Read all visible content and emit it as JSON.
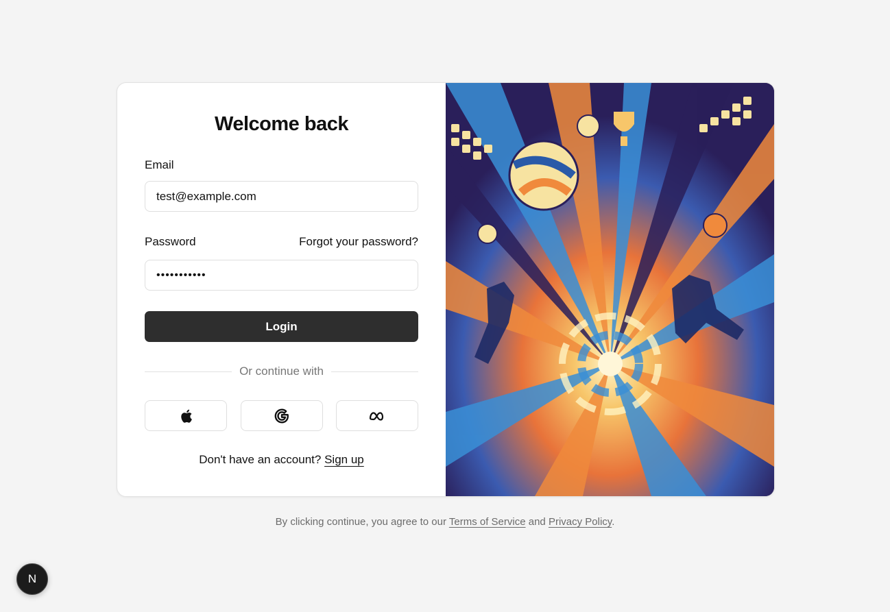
{
  "login_form": {
    "title": "Welcome back",
    "email_label": "Email",
    "email_value": "test@example.com",
    "password_label": "Password",
    "forgot_password": "Forgot your password?",
    "password_value": "•••••••••••",
    "login_button": "Login",
    "divider_text": "Or continue with",
    "social_buttons": [
      {
        "provider_icon": "apple-icon"
      },
      {
        "provider_icon": "google-icon"
      },
      {
        "provider_icon": "meta-icon"
      }
    ],
    "signup_prompt": "Don't have an account?",
    "signup_link": "Sign up"
  },
  "footer": {
    "prefix": "By clicking continue, you agree to our",
    "terms": "Terms of Service",
    "and": "and",
    "privacy": "Privacy Policy",
    "suffix": "."
  },
  "dev_badge": {
    "letter": "N"
  },
  "colors": {
    "page_bg": "#f4f4f4",
    "button_bg": "#2e2e2e",
    "art_orange": "#f08a3c",
    "art_blue": "#3a8fd6",
    "art_navy": "#2a1f5a",
    "art_cream": "#f7e3a1"
  }
}
